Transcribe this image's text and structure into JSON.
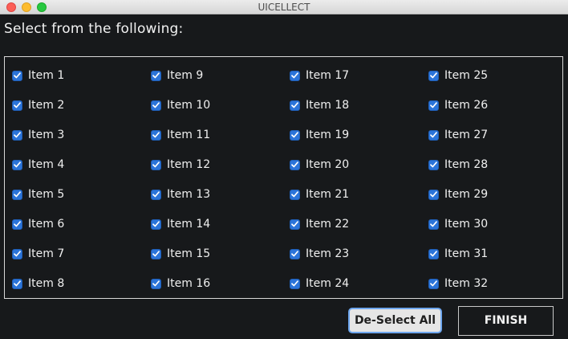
{
  "window": {
    "title": "UICELLECT"
  },
  "prompt": "Select from the following:",
  "items": [
    {
      "label": "Item 1",
      "checked": true
    },
    {
      "label": "Item 2",
      "checked": true
    },
    {
      "label": "Item 3",
      "checked": true
    },
    {
      "label": "Item 4",
      "checked": true
    },
    {
      "label": "Item 5",
      "checked": true
    },
    {
      "label": "Item 6",
      "checked": true
    },
    {
      "label": "Item 7",
      "checked": true
    },
    {
      "label": "Item 8",
      "checked": true
    },
    {
      "label": "Item 9",
      "checked": true
    },
    {
      "label": "Item 10",
      "checked": true
    },
    {
      "label": "Item 11",
      "checked": true
    },
    {
      "label": "Item 12",
      "checked": true
    },
    {
      "label": "Item 13",
      "checked": true
    },
    {
      "label": "Item 14",
      "checked": true
    },
    {
      "label": "Item 15",
      "checked": true
    },
    {
      "label": "Item 16",
      "checked": true
    },
    {
      "label": "Item 17",
      "checked": true
    },
    {
      "label": "Item 18",
      "checked": true
    },
    {
      "label": "Item 19",
      "checked": true
    },
    {
      "label": "Item 20",
      "checked": true
    },
    {
      "label": "Item 21",
      "checked": true
    },
    {
      "label": "Item 22",
      "checked": true
    },
    {
      "label": "Item 23",
      "checked": true
    },
    {
      "label": "Item 24",
      "checked": true
    },
    {
      "label": "Item 25",
      "checked": true
    },
    {
      "label": "Item 26",
      "checked": true
    },
    {
      "label": "Item 27",
      "checked": true
    },
    {
      "label": "Item 28",
      "checked": true
    },
    {
      "label": "Item 29",
      "checked": true
    },
    {
      "label": "Item 30",
      "checked": true
    },
    {
      "label": "Item 31",
      "checked": true
    },
    {
      "label": "Item 32",
      "checked": true
    }
  ],
  "buttons": {
    "deselect_all": "De-Select All",
    "finish": "FINISH"
  },
  "colors": {
    "background": "#17191b",
    "checkbox_accent": "#2b74d9",
    "focus_ring": "#6ea6ee"
  }
}
